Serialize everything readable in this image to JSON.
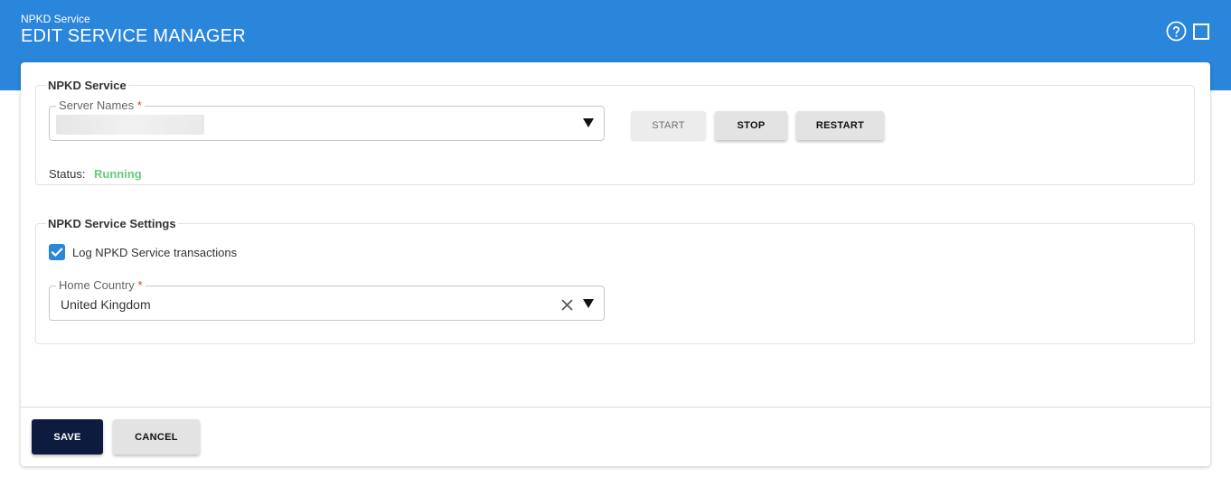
{
  "header": {
    "subtitle": "NPKD Service",
    "title": "EDIT SERVICE MANAGER",
    "help_icon": "help-circle-icon",
    "maximize_icon": "maximize-icon",
    "color": "#2a86db"
  },
  "service_section": {
    "legend": "NPKD Service",
    "server_names": {
      "label": "Server Names",
      "required_mark": "*",
      "value": ""
    },
    "buttons": {
      "start": "START",
      "stop": "STOP",
      "restart": "RESTART"
    },
    "status": {
      "label": "Status:",
      "value": "Running",
      "color": "#66cc7a"
    }
  },
  "settings_section": {
    "legend": "NPKD Service Settings",
    "log_transactions": {
      "label": "Log NPKD Service transactions",
      "checked": true
    },
    "home_country": {
      "label": "Home Country",
      "required_mark": "*",
      "value": "United Kingdom"
    }
  },
  "footer": {
    "save": "SAVE",
    "cancel": "CANCEL",
    "save_color": "#0d1b3e"
  }
}
